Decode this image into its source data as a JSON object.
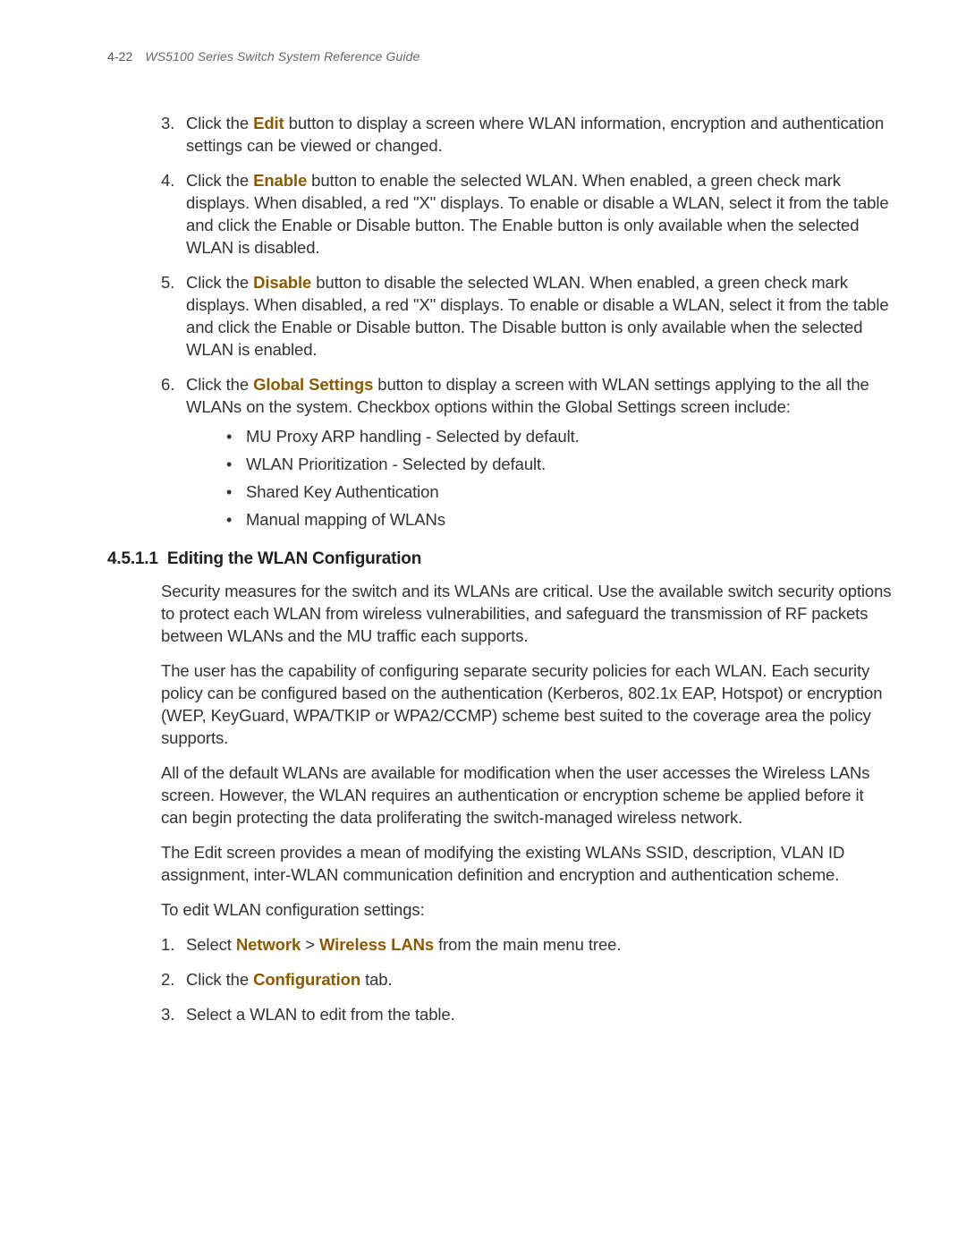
{
  "header": {
    "page_number": "4-22",
    "doc_title": "WS5100 Series Switch System Reference Guide"
  },
  "list1": {
    "item3": {
      "num": "3.",
      "pre": "Click the ",
      "bold": "Edit",
      "post": " button to display a screen where WLAN information, encryption and authentication settings can be viewed or changed."
    },
    "item4": {
      "num": "4.",
      "pre": "Click the ",
      "bold": "Enable",
      "post": " button to enable the selected WLAN. When enabled, a green check mark displays. When disabled, a red \"X\" displays. To enable or disable a WLAN, select it from the table and click the Enable or Disable button. The Enable button is only available when the selected WLAN is disabled."
    },
    "item5": {
      "num": "5.",
      "pre": "Click the ",
      "bold": "Disable",
      "post": " button to disable the selected WLAN. When enabled, a green check mark displays. When disabled, a red \"X\" displays. To enable or disable a WLAN, select it from the table and click the Enable or Disable button. The Disable button is only available when the selected WLAN is enabled."
    },
    "item6": {
      "num": "6.",
      "pre": "Click the ",
      "bold": "Global Settings",
      "post": " button to display a screen with WLAN settings applying to the all the WLANs on the system. Checkbox options within the Global Settings screen include:"
    }
  },
  "bullets": {
    "b1": "MU Proxy ARP handling - Selected by default.",
    "b2": "WLAN Prioritization - Selected by default.",
    "b3": "Shared Key Authentication",
    "b4": "Manual mapping of WLANs"
  },
  "section": {
    "number": "4.5.1.1",
    "title": "Editing the WLAN Configuration"
  },
  "paras": {
    "p1": "Security measures for the switch and its WLANs are critical. Use the available switch security options to protect each WLAN from wireless vulnerabilities, and safeguard the transmission of RF packets between WLANs and the MU traffic each supports.",
    "p2": "The user has the capability of configuring separate security policies for each WLAN. Each security policy can be configured based on the authentication (Kerberos, 802.1x EAP, Hotspot) or encryption (WEP, KeyGuard, WPA/TKIP or WPA2/CCMP) scheme best suited to the coverage area the policy supports.",
    "p3": "All of the default WLANs are available for modification when the user accesses the Wireless LANs screen. However, the WLAN requires an authentication or encryption scheme be applied before it can begin protecting the data proliferating the switch-managed wireless network.",
    "p4": "The Edit screen provides a mean of modifying the existing WLANs SSID, description, VLAN ID assignment, inter-WLAN communication definition and encryption and authentication scheme.",
    "p5": "To edit WLAN configuration settings:"
  },
  "list2": {
    "item1": {
      "num": "1.",
      "pre": "Select ",
      "bold1": "Network",
      "mid": " > ",
      "bold2": "Wireless LANs",
      "post": " from the main menu tree."
    },
    "item2": {
      "num": "2.",
      "pre": "Click the ",
      "bold": "Configuration",
      "post": " tab."
    },
    "item3": {
      "num": "3.",
      "text": "Select a WLAN to edit from the table."
    }
  }
}
